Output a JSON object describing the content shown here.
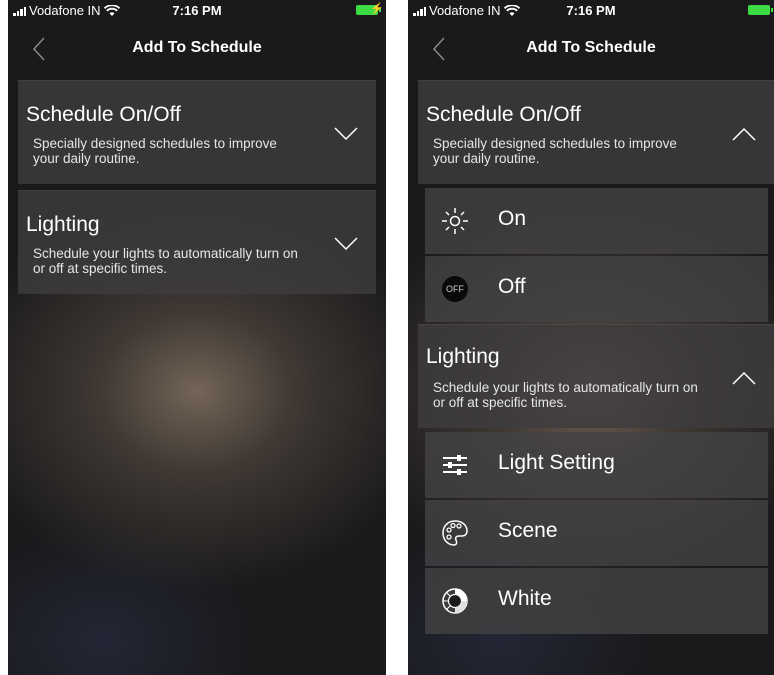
{
  "left_screen": {
    "status": {
      "carrier": "Vodafone IN",
      "time": "7:16 PM"
    },
    "nav": {
      "title": "Add To Schedule",
      "back_icon": "chevron-left-icon"
    },
    "sections": [
      {
        "title": "Schedule On/Off",
        "description": "Specially designed schedules to improve your daily routine.",
        "state": "collapsed",
        "toggle_icon": "chevron-down-icon"
      },
      {
        "title": "Lighting",
        "description": "Schedule your lights to automatically turn on or off at specific times.",
        "state": "collapsed",
        "toggle_icon": "chevron-down-icon"
      }
    ]
  },
  "right_screen": {
    "status": {
      "carrier": "Vodafone IN",
      "time": "7:16 PM"
    },
    "nav": {
      "title": "Add To Schedule",
      "back_icon": "chevron-left-icon"
    },
    "sections": [
      {
        "title": "Schedule On/Off",
        "description": "Specially designed schedules to improve your daily routine.",
        "state": "expanded",
        "toggle_icon": "chevron-up-icon",
        "items": [
          {
            "label": "On",
            "icon": "sun-icon"
          },
          {
            "label": "Off",
            "icon": "off-badge-icon",
            "badge": "OFF"
          }
        ]
      },
      {
        "title": "Lighting",
        "description": "Schedule your lights to automatically turn on or off at specific times.",
        "state": "expanded",
        "toggle_icon": "chevron-up-icon",
        "items": [
          {
            "label": "Light Setting",
            "icon": "sliders-icon"
          },
          {
            "label": "Scene",
            "icon": "palette-icon"
          },
          {
            "label": "White",
            "icon": "white-ring-icon"
          }
        ]
      }
    ]
  },
  "colors": {
    "battery": "#3ddc45",
    "panel": "#3e3c3e",
    "text": "#ffffff"
  }
}
